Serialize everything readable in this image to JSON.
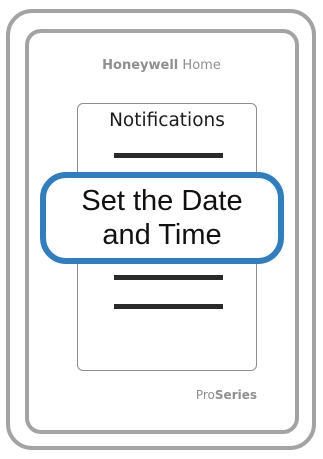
{
  "brand": {
    "name_bold": "Honeywell",
    "name_light": "Home"
  },
  "screen": {
    "title": "Notifications",
    "selected_item_line1": "Set the Date",
    "selected_item_line2": "and Time"
  },
  "series": {
    "prefix": "Pro",
    "suffix": "Series"
  },
  "colors": {
    "device_frame": "#a3a3a3",
    "highlight_border": "#2f7ebf",
    "bar": "#2a2a2a"
  }
}
